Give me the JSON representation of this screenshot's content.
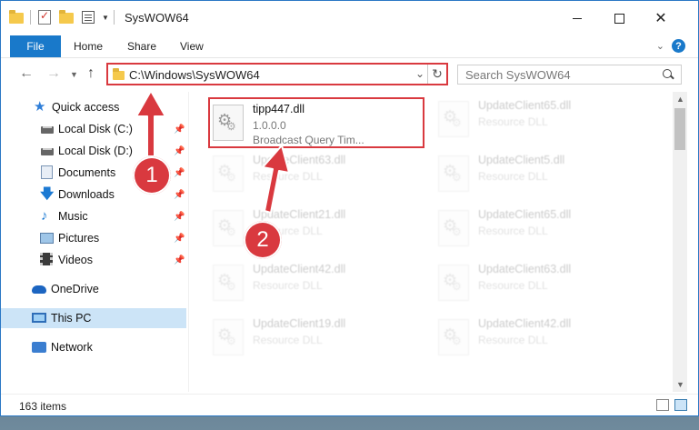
{
  "window": {
    "title": "SysWOW64"
  },
  "ribbon": {
    "tabs": [
      "File",
      "Home",
      "Share",
      "View"
    ]
  },
  "address": {
    "path": "C:\\Windows\\SysWOW64",
    "search_placeholder": "Search SysWOW64"
  },
  "sidebar": {
    "items": [
      {
        "label": "Quick access",
        "icon": "star-icon",
        "pinned": false
      },
      {
        "label": "Local Disk (C:)",
        "icon": "disk-icon",
        "pinned": true
      },
      {
        "label": "Local Disk (D:)",
        "icon": "disk-icon",
        "pinned": true
      },
      {
        "label": "Documents",
        "icon": "documents-icon",
        "pinned": true
      },
      {
        "label": "Downloads",
        "icon": "download-icon",
        "pinned": true
      },
      {
        "label": "Music",
        "icon": "music-icon",
        "pinned": true
      },
      {
        "label": "Pictures",
        "icon": "pictures-icon",
        "pinned": true
      },
      {
        "label": "Videos",
        "icon": "videos-icon",
        "pinned": true
      },
      {
        "label": "OneDrive",
        "icon": "cloud-icon",
        "pinned": false
      },
      {
        "label": "This PC",
        "icon": "computer-icon",
        "pinned": false,
        "selected": true
      },
      {
        "label": "Network",
        "icon": "network-icon",
        "pinned": false
      }
    ]
  },
  "files": [
    {
      "name": "tipp447.dll",
      "line2": "1.0.0.0",
      "line3": "Broadcast Query Tim...",
      "highlighted": true
    },
    {
      "name": "UpdateClient65.dll",
      "line2": "Resource DLL"
    },
    {
      "name": "UpdateClient63.dll",
      "line2": "Resource DLL"
    },
    {
      "name": "UpdateClient5.dll",
      "line2": "Resource DLL"
    },
    {
      "name": "UpdateClient21.dll",
      "line2": "Resource DLL"
    },
    {
      "name": "UpdateClient65.dll",
      "line2": "Resource DLL"
    },
    {
      "name": "UpdateClient42.dll",
      "line2": "Resource DLL"
    },
    {
      "name": "UpdateClient63.dll",
      "line2": "Resource DLL"
    },
    {
      "name": "UpdateClient19.dll",
      "line2": "Resource DLL"
    },
    {
      "name": "UpdateClient42.dll",
      "line2": "Resource DLL"
    }
  ],
  "status": {
    "item_count": "163 items"
  },
  "annotations": {
    "step1": "1",
    "step2": "2",
    "color": "#d9393f"
  }
}
